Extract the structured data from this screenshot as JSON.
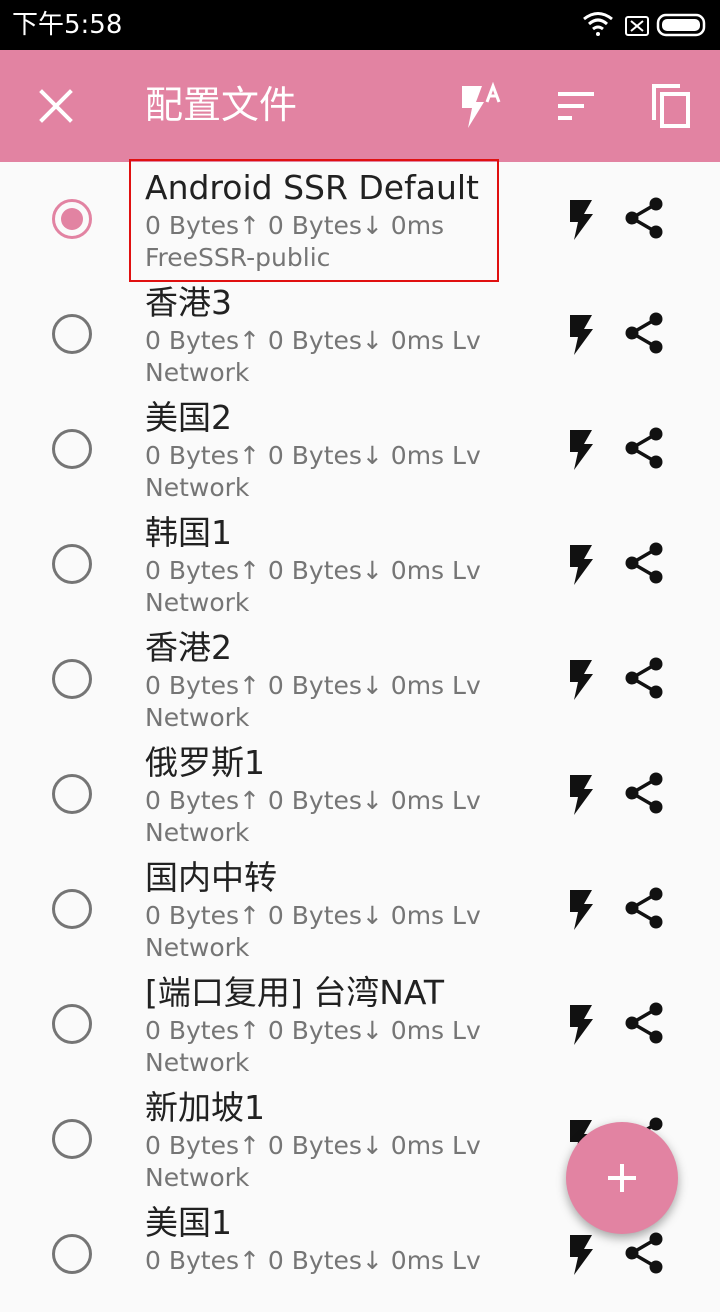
{
  "status_bar": {
    "time": "下午5:58"
  },
  "app_bar": {
    "title": "配置文件"
  },
  "colors": {
    "accent": "#e283a2",
    "highlight": "#e01010"
  },
  "profiles": [
    {
      "name": "Android SSR Default",
      "stats": "0 Bytes↑ 0 Bytes↓ 0ms",
      "subtitle": "FreeSSR-public",
      "selected": true
    },
    {
      "name": "香港3",
      "stats": "0 Bytes↑ 0 Bytes↓ 0ms Lv",
      "subtitle": "Network",
      "selected": false
    },
    {
      "name": "美国2",
      "stats": "0 Bytes↑ 0 Bytes↓ 0ms Lv",
      "subtitle": "Network",
      "selected": false
    },
    {
      "name": "韩国1",
      "stats": "0 Bytes↑ 0 Bytes↓ 0ms Lv",
      "subtitle": "Network",
      "selected": false
    },
    {
      "name": "香港2",
      "stats": "0 Bytes↑ 0 Bytes↓ 0ms Lv",
      "subtitle": "Network",
      "selected": false
    },
    {
      "name": "俄罗斯1",
      "stats": "0 Bytes↑ 0 Bytes↓ 0ms Lv",
      "subtitle": "Network",
      "selected": false
    },
    {
      "name": "国内中转",
      "stats": "0 Bytes↑ 0 Bytes↓ 0ms Lv",
      "subtitle": "Network",
      "selected": false
    },
    {
      "name": "[端口复用] 台湾NAT",
      "stats": "0 Bytes↑ 0 Bytes↓ 0ms Lv",
      "subtitle": "Network",
      "selected": false
    },
    {
      "name": "新加坡1",
      "stats": "0 Bytes↑ 0 Bytes↓ 0ms Lv",
      "subtitle": "Network",
      "selected": false
    },
    {
      "name": "美国1",
      "stats": "0 Bytes↑ 0 Bytes↓ 0ms Lv",
      "subtitle": "",
      "selected": false
    }
  ]
}
